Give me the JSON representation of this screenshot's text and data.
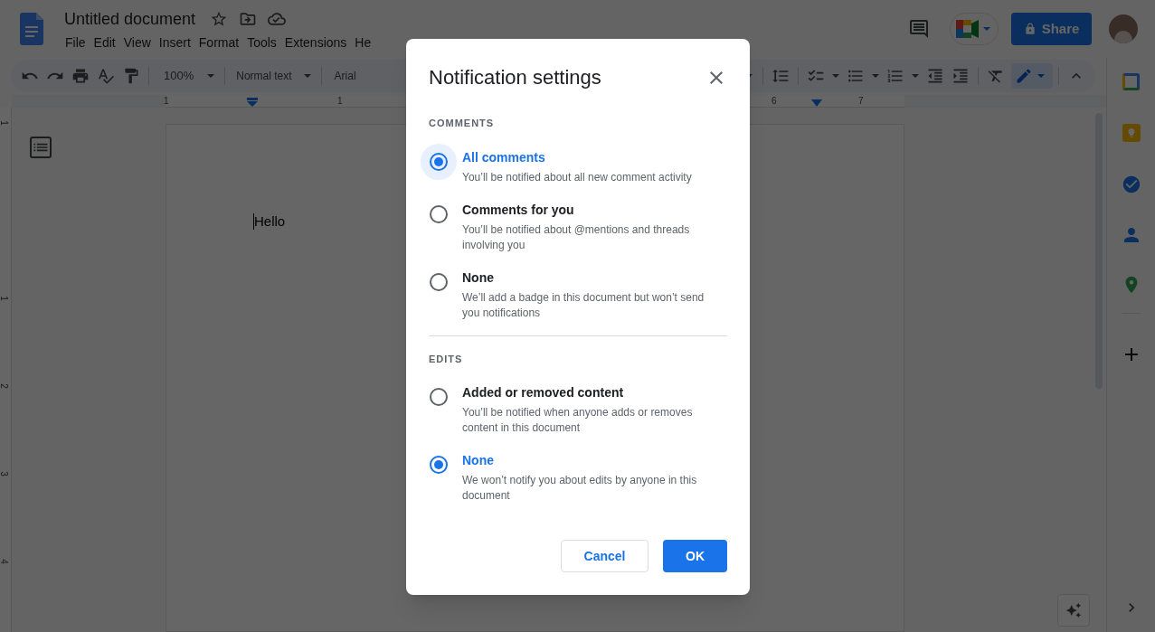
{
  "app": {
    "title": "Untitled document",
    "menu": [
      "File",
      "Edit",
      "View",
      "Insert",
      "Format",
      "Tools",
      "Extensions",
      "He"
    ],
    "share_label": "Share"
  },
  "toolbar": {
    "zoom": "100%",
    "style": "Normal text",
    "font": "Arial"
  },
  "ruler": {
    "top_labels": [
      "1",
      "1",
      "6",
      "7"
    ],
    "side_labels": [
      "1",
      "1",
      "2",
      "3",
      "4"
    ]
  },
  "document": {
    "text": "Hello"
  },
  "dialog": {
    "title": "Notification settings",
    "sections": [
      {
        "heading": "COMMENTS",
        "options": [
          {
            "label": "All comments",
            "description": "You’ll be notified about all new comment activity",
            "selected": true,
            "focused": true
          },
          {
            "label": "Comments for you",
            "description": "You’ll be notified about @mentions and threads involving you",
            "selected": false,
            "focused": false
          },
          {
            "label": "None",
            "description": "We’ll add a badge in this document but won’t send you notifications",
            "selected": false,
            "focused": false
          }
        ]
      },
      {
        "heading": "EDITS",
        "options": [
          {
            "label": "Added or removed content",
            "description": "You’ll be notified when anyone adds or removes content in this document",
            "selected": false,
            "focused": false
          },
          {
            "label": "None",
            "description": "We won’t notify you about edits by anyone in this document",
            "selected": true,
            "focused": false
          }
        ]
      }
    ],
    "buttons": [
      {
        "label": "Cancel",
        "kind": "secondary"
      },
      {
        "label": "OK",
        "kind": "primary"
      }
    ]
  }
}
